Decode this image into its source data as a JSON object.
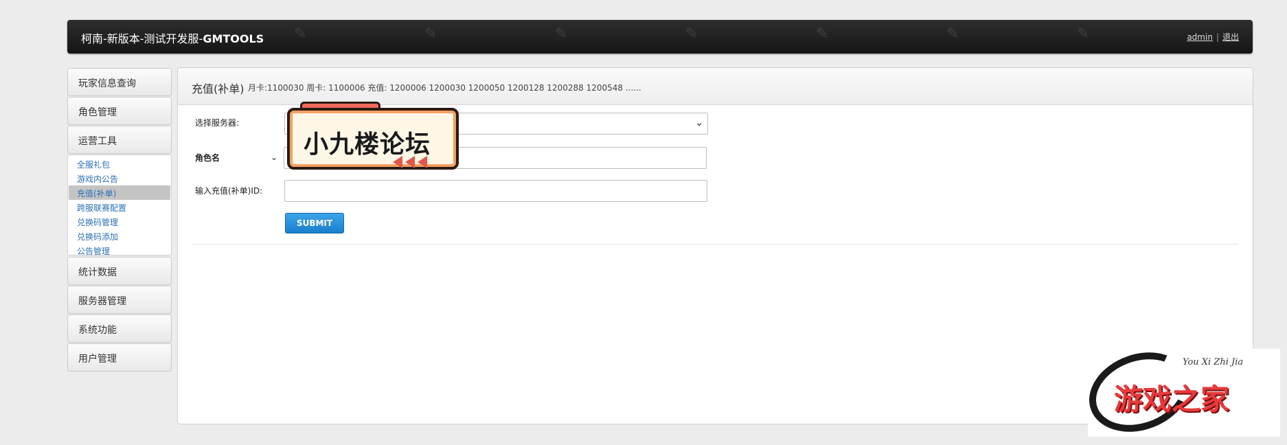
{
  "header": {
    "title_prefix": "柯南-新版本-测试开发服-",
    "title_brand": "GMTOOLS",
    "user_link": "admin",
    "separator": "|",
    "logout_link": "退出"
  },
  "sidebar": {
    "items_top": [
      {
        "label": "玩家信息查询"
      },
      {
        "label": "角色管理"
      },
      {
        "label": "运营工具"
      }
    ],
    "submenu": [
      {
        "label": "全服礼包"
      },
      {
        "label": "游戏内公告"
      },
      {
        "label": "充值(补单)"
      },
      {
        "label": "跨服联赛配置"
      },
      {
        "label": "兑换码管理"
      },
      {
        "label": "兑换码添加"
      },
      {
        "label": "公告管理"
      }
    ],
    "active_submenu": "充值(补单)",
    "items_bottom": [
      {
        "label": "统计数据"
      },
      {
        "label": "服务器管理"
      },
      {
        "label": "系统功能"
      },
      {
        "label": "用户管理"
      }
    ]
  },
  "panel": {
    "title": "充值(补单)",
    "note": "月卡:1100030 周卡: 1100006 充值: 1200006 1200030 1200050 1200128 1200288 1200548 ......",
    "form": {
      "server_label": "选择服务器:",
      "server_value": "",
      "role_label": "角色名",
      "role_value": "",
      "recharge_label": "输入充值(补单)ID:",
      "recharge_value": "",
      "submit_label": "SUBMIT"
    }
  },
  "overlay_badge": {
    "text": "小九楼论坛"
  },
  "corner_logo": {
    "script": "You Xi Zhi Jia",
    "text": "游戏之家"
  },
  "colors": {
    "header_bg": "#1e1e1e",
    "link_blue": "#2a6fb8",
    "submit_blue": "#1a7fcc",
    "active_item_bg": "#c4c4c4"
  }
}
